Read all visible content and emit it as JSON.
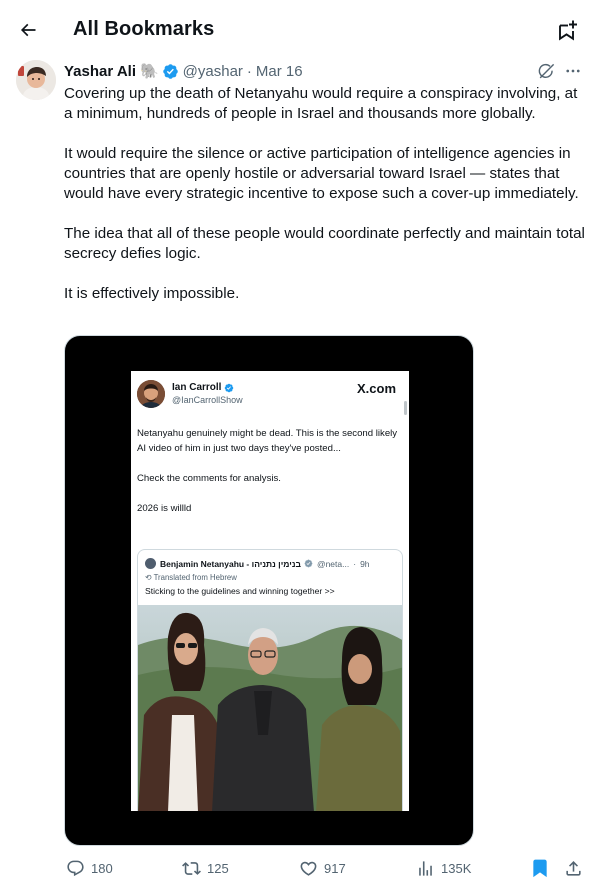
{
  "header": {
    "title": "All Bookmarks",
    "back_icon": "arrow-left-icon",
    "action_icon": "bookmark-folder-add-icon"
  },
  "tweet": {
    "author_name": "Yashar Ali",
    "author_emoji": "🐘",
    "handle": "@yashar",
    "separator": "·",
    "date": "Mar 16",
    "paragraphs": [
      "Covering up the death of Netanyahu would require a conspiracy involving, at a minimum, hundreds of people in Israel and thousands more globally.",
      "It would require the silence or active participation of intelligence agencies in countries that are openly hostile or adversarial toward Israel — states that would have every strategic incentive to expose such a cover-up immediately.",
      "The idea that all of these people would coordinate perfectly and maintain total secrecy defies logic.",
      "It is effectively impossible."
    ]
  },
  "embedded_post": {
    "name": "Ian Carroll",
    "handle": "@IanCarrollShow",
    "logo": "X.com",
    "paragraphs": [
      "Netanyahu genuinely might be dead. This is the second likely AI video of him in just two days they've posted...",
      "Check the comments for analysis.",
      "2026 is willld"
    ],
    "quote": {
      "name": "Benjamin Netanyahu - בנימין נתניהו",
      "handle": "@neta...",
      "separator": "·",
      "time": "9h",
      "translated": "Translated from Hebrew",
      "text": "Sticking to the guidelines and winning together >>"
    }
  },
  "actions": {
    "replies": "180",
    "reposts": "125",
    "likes": "917",
    "views": "135K"
  },
  "colors": {
    "accent": "#1d9bf0",
    "text_primary": "#0f1419",
    "text_secondary": "#536471",
    "border": "#cfd9de"
  }
}
